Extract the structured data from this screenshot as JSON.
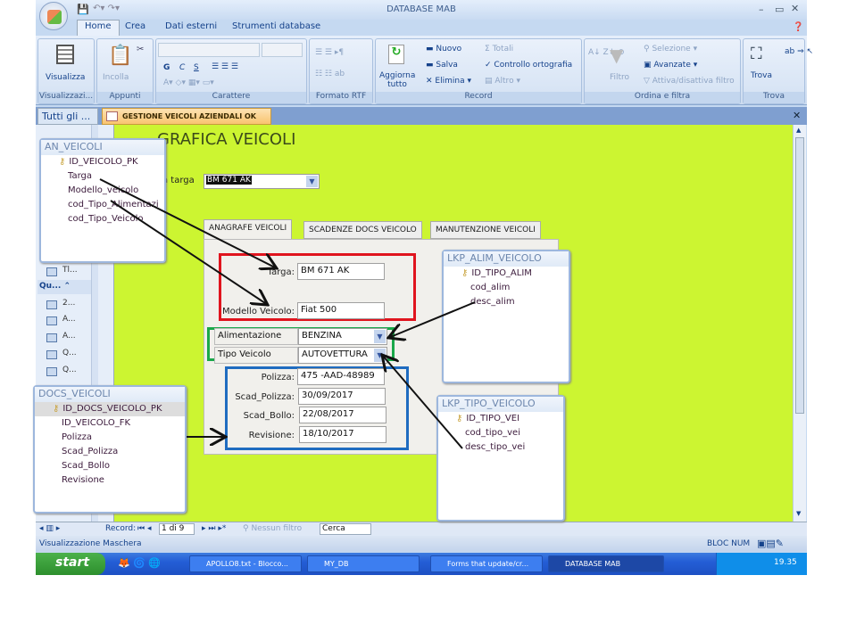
{
  "window": {
    "title": "DATABASE MAB"
  },
  "ribbon_tabs": [
    "Home",
    "Crea",
    "Dati esterni",
    "Strumenti database"
  ],
  "ribbon": {
    "visualizza": "Visualizza",
    "visualizza_group": "Visualizzazi...",
    "incolla": "Incolla",
    "appunti_group": "Appunti",
    "carattere_group": "Carattere",
    "bold": "G",
    "italic": "C",
    "underline": "S",
    "formato_rtf_group": "Formato RTF",
    "aggiorna": "Aggiorna tutto",
    "nuovo": "Nuovo",
    "salva": "Salva",
    "elimina": "Elimina",
    "totali": "Totali",
    "controllo": "Controllo ortografia",
    "altro": "Altro",
    "record_group": "Record",
    "filtro": "Filtro",
    "selezione": "Selezione",
    "avanzate": "Avanzate",
    "attiva": "Attiva/disattiva filtro",
    "ordina_group": "Ordina e filtra",
    "trova": "Trova",
    "trova_group": "Trova"
  },
  "nav": {
    "header": "Tutti gli ...",
    "section": "Qu...",
    "items": [
      "Tl...",
      "2...",
      "A...",
      "A...",
      "Q...",
      "Q..."
    ]
  },
  "doc_tab": "GESTIONE VEICOLI AZIENDALI OK",
  "form": {
    "title": "GRAFICA VEICOLI",
    "search_label": "a targa",
    "search_value": "BM 671 AK",
    "tabs": [
      "ANAGRAFE VEICOLI",
      "SCADENZE DOCS VEICOLO",
      "MANUTENZIONE VEICOLI"
    ],
    "fields": {
      "targa": {
        "label": "Targa:",
        "value": "BM 671 AK"
      },
      "modello": {
        "label": "Modello Veicolo:",
        "value": "Fiat 500"
      },
      "alimentazione": {
        "label": "Alimentazione",
        "value": "BENZINA"
      },
      "tipo": {
        "label": "Tipo Veicolo",
        "value": "AUTOVETTURA"
      },
      "polizza": {
        "label": "Polizza:",
        "value": "475 -AAD-48989"
      },
      "scad_polizza": {
        "label": "Scad_Polizza:",
        "value": "30/09/2017"
      },
      "scad_bollo": {
        "label": "Scad_Bollo:",
        "value": "22/08/2017"
      },
      "revisione": {
        "label": "Revisione:",
        "value": "18/10/2017"
      }
    }
  },
  "tables": {
    "an_veicoli": {
      "name": "AN_VEICOLI",
      "fields": [
        "ID_VEICOLO_PK",
        "Targa",
        "Modello_veicolo",
        "cod_Tipo_Alimentazi",
        "cod_Tipo_Veicolo"
      ]
    },
    "docs_veicoli": {
      "name": "DOCS_VEICOLI",
      "fields": [
        "ID_DOCS_VEICOLO_PK",
        "ID_VEICOLO_FK",
        "Polizza",
        "Scad_Polizza",
        "Scad_Bollo",
        "Revisione"
      ]
    },
    "lkp_alim": {
      "name": "LKP_ALIM_VEICOLO",
      "fields": [
        "ID_TIPO_ALIM",
        "cod_alim",
        "desc_alim"
      ]
    },
    "lkp_tipo": {
      "name": "LKP_TIPO_VEICOLO",
      "fields": [
        "ID_TIPO_VEI",
        "cod_tipo_vei",
        "desc_tipo_vei"
      ]
    }
  },
  "record_nav": {
    "label": "Record:",
    "position": "1 di 9",
    "filter": "Nessun filtro",
    "search": "Cerca"
  },
  "status": {
    "left": "Visualizzazione Maschera",
    "right": "BLOC NUM"
  },
  "taskbar": {
    "start": "start",
    "tasks": [
      "APOLLO8.txt - Blocco...",
      "MY_DB",
      "Forms that update/cr...",
      "DATABASE MAB"
    ],
    "clock": "19.35"
  },
  "colors": {
    "form_bg": "#ccf531",
    "red_box": "#e0141e",
    "green_box": "#1aa84a",
    "blue_box": "#1f6cc0"
  }
}
